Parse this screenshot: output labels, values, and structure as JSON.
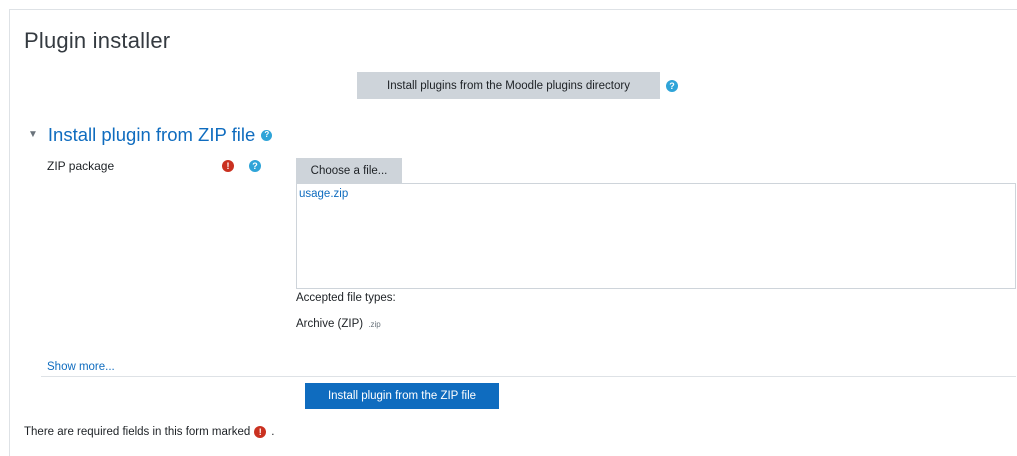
{
  "page": {
    "title": "Plugin installer"
  },
  "directory": {
    "button_label": "Install plugins from the Moodle plugins directory",
    "help_icon": "?"
  },
  "zip_section": {
    "caret": "▼",
    "heading": "Install plugin from ZIP file",
    "help_icon": "?",
    "field_label": "ZIP package",
    "required_icon": "!",
    "field_help_icon": "?",
    "choose_button": "Choose a file...",
    "selected_file": "usage.zip",
    "accepted_label": "Accepted file types:",
    "archive_type": "Archive (ZIP)",
    "archive_ext": ".zip"
  },
  "show_more": "Show more...",
  "install_button": "Install plugin from the ZIP file",
  "required_note": {
    "prefix": "There are required fields in this form marked",
    "icon": "!",
    "suffix": "."
  },
  "colors": {
    "accent": "#0f6cbf",
    "help": "#2fa4d8",
    "required": "#ca3120",
    "button_gray": "#ced4da"
  }
}
